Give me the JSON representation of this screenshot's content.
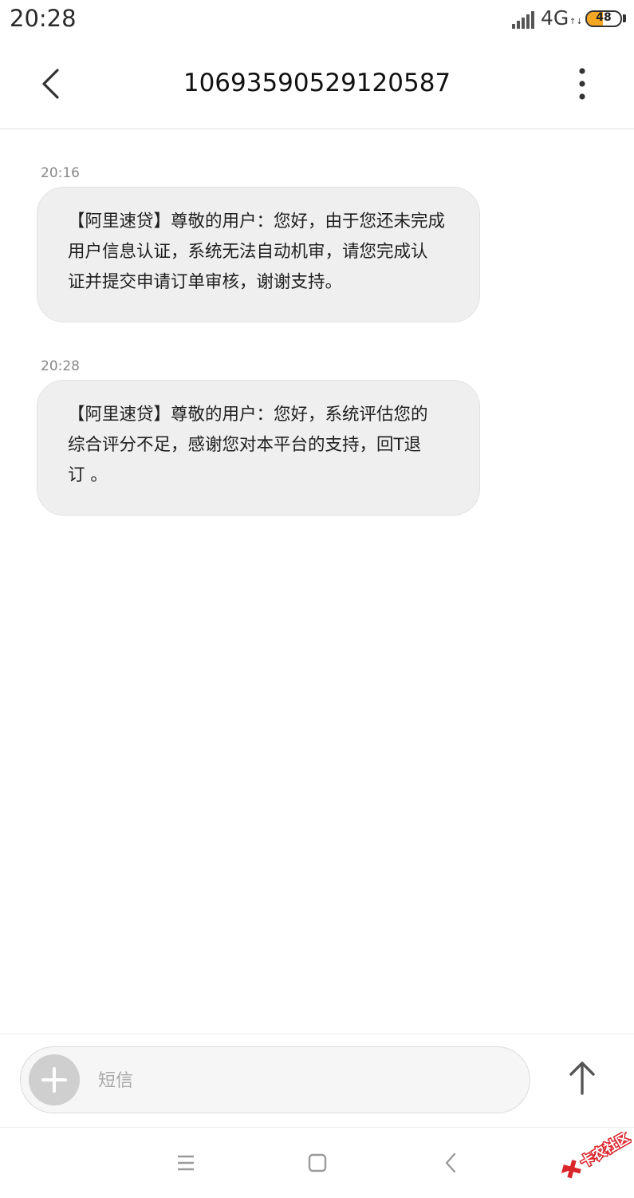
{
  "status_bar": {
    "time": "20:28",
    "network": "4G",
    "network_activity": "↑↓",
    "battery_level": "48",
    "battery_fraction": 0.48,
    "battery_color": "#f5a623",
    "icons": [
      "signal-icon",
      "battery-icon"
    ]
  },
  "header": {
    "title": "10693590529120587",
    "back_icon": "chevron-left-icon",
    "more_icon": "more-vertical-icon"
  },
  "messages": [
    {
      "time": "20:16",
      "text": "【阿里速贷】尊敬的用户：您好，由于您还未完成用户信息认证，系统无法自动机审，请您完成认证并提交申请订单审核，谢谢支持。",
      "lines": [
        "【阿里速贷】尊敬的用户：您好，由于您还未完成",
        "用户信息认证，系统无法自动机审，请您完成认",
        "证并提交申请订单审核，谢谢支持。"
      ]
    },
    {
      "time": "20:28",
      "text": "【阿里速贷】尊敬的用户：您好，系统评估您的综合评分不足，感谢您对本平台的支持，回T退订 。",
      "lines": [
        "【阿里速贷】尊敬的用户：您好，系统评估您的",
        "综合评分不足，感谢您对本平台的支持，回T退",
        "订 。"
      ]
    }
  ],
  "composer": {
    "placeholder": "短信",
    "value": "",
    "add_icon": "plus-icon",
    "send_icon": "arrow-up-icon"
  },
  "nav_bar": {
    "icons": [
      "menu-icon",
      "home-square-icon",
      "back-triangle-icon"
    ]
  },
  "watermark": {
    "text": "卡农社区",
    "color": "#d9262b"
  }
}
